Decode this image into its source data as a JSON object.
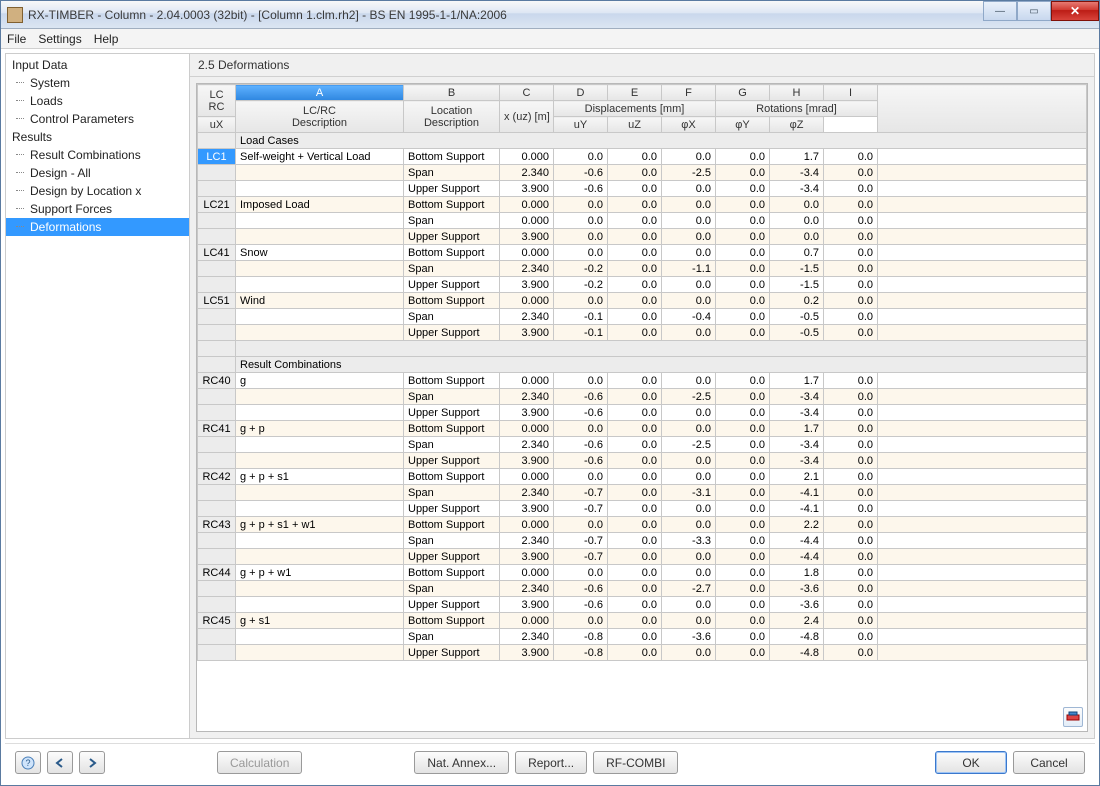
{
  "window": {
    "title": "RX-TIMBER - Column - 2.04.0003 (32bit) - [Column 1.clm.rh2] - BS EN 1995-1-1/NA:2006"
  },
  "menu": {
    "file": "File",
    "settings": "Settings",
    "help": "Help"
  },
  "tree": {
    "groups": [
      {
        "label": "Input Data",
        "items": [
          "System",
          "Loads",
          "Control Parameters"
        ]
      },
      {
        "label": "Results",
        "items": [
          "Result Combinations",
          "Design - All",
          "Design by Location x",
          "Support Forces",
          "Deformations"
        ],
        "selected": "Deformations"
      }
    ]
  },
  "panel": {
    "title": "2.5 Deformations"
  },
  "columns": {
    "letters": [
      "A",
      "B",
      "C",
      "D",
      "E",
      "F",
      "G",
      "H",
      "I"
    ],
    "lc": "LC\nRC",
    "a": "LC/RC\nDescription",
    "b": "Location\nDescription",
    "c": "x (uz) [m]",
    "disp_group": "Displacements [mm]",
    "d": "uX",
    "e": "uY",
    "f": "uZ",
    "rot_group": "Rotations [mrad]",
    "g": "φX",
    "h": "φY",
    "i": "φZ"
  },
  "sections": [
    {
      "title": "Load Cases",
      "rows": [
        {
          "lc": "LC1",
          "desc": "Self-weight + Vertical Load",
          "loc": "Bottom Support",
          "x": "0.000",
          "ux": "0.0",
          "uy": "0.0",
          "uz": "0.0",
          "px": "0.0",
          "py": "1.7",
          "pz": "0.0",
          "selected": true
        },
        {
          "lc": "",
          "desc": "",
          "loc": "Span",
          "x": "2.340",
          "ux": "-0.6",
          "uy": "0.0",
          "uz": "-2.5",
          "px": "0.0",
          "py": "-3.4",
          "pz": "0.0"
        },
        {
          "lc": "",
          "desc": "",
          "loc": "Upper Support",
          "x": "3.900",
          "ux": "-0.6",
          "uy": "0.0",
          "uz": "0.0",
          "px": "0.0",
          "py": "-3.4",
          "pz": "0.0"
        },
        {
          "lc": "LC21",
          "desc": "Imposed Load",
          "loc": "Bottom Support",
          "x": "0.000",
          "ux": "0.0",
          "uy": "0.0",
          "uz": "0.0",
          "px": "0.0",
          "py": "0.0",
          "pz": "0.0"
        },
        {
          "lc": "",
          "desc": "",
          "loc": "Span",
          "x": "0.000",
          "ux": "0.0",
          "uy": "0.0",
          "uz": "0.0",
          "px": "0.0",
          "py": "0.0",
          "pz": "0.0"
        },
        {
          "lc": "",
          "desc": "",
          "loc": "Upper Support",
          "x": "3.900",
          "ux": "0.0",
          "uy": "0.0",
          "uz": "0.0",
          "px": "0.0",
          "py": "0.0",
          "pz": "0.0"
        },
        {
          "lc": "LC41",
          "desc": "Snow",
          "loc": "Bottom Support",
          "x": "0.000",
          "ux": "0.0",
          "uy": "0.0",
          "uz": "0.0",
          "px": "0.0",
          "py": "0.7",
          "pz": "0.0"
        },
        {
          "lc": "",
          "desc": "",
          "loc": "Span",
          "x": "2.340",
          "ux": "-0.2",
          "uy": "0.0",
          "uz": "-1.1",
          "px": "0.0",
          "py": "-1.5",
          "pz": "0.0"
        },
        {
          "lc": "",
          "desc": "",
          "loc": "Upper Support",
          "x": "3.900",
          "ux": "-0.2",
          "uy": "0.0",
          "uz": "0.0",
          "px": "0.0",
          "py": "-1.5",
          "pz": "0.0"
        },
        {
          "lc": "LC51",
          "desc": "Wind",
          "loc": "Bottom Support",
          "x": "0.000",
          "ux": "0.0",
          "uy": "0.0",
          "uz": "0.0",
          "px": "0.0",
          "py": "0.2",
          "pz": "0.0"
        },
        {
          "lc": "",
          "desc": "",
          "loc": "Span",
          "x": "2.340",
          "ux": "-0.1",
          "uy": "0.0",
          "uz": "-0.4",
          "px": "0.0",
          "py": "-0.5",
          "pz": "0.0"
        },
        {
          "lc": "",
          "desc": "",
          "loc": "Upper Support",
          "x": "3.900",
          "ux": "-0.1",
          "uy": "0.0",
          "uz": "0.0",
          "px": "0.0",
          "py": "-0.5",
          "pz": "0.0"
        }
      ]
    },
    {
      "title": "Result Combinations",
      "rows": [
        {
          "lc": "RC40",
          "desc": "g",
          "loc": "Bottom Support",
          "x": "0.000",
          "ux": "0.0",
          "uy": "0.0",
          "uz": "0.0",
          "px": "0.0",
          "py": "1.7",
          "pz": "0.0"
        },
        {
          "lc": "",
          "desc": "",
          "loc": "Span",
          "x": "2.340",
          "ux": "-0.6",
          "uy": "0.0",
          "uz": "-2.5",
          "px": "0.0",
          "py": "-3.4",
          "pz": "0.0"
        },
        {
          "lc": "",
          "desc": "",
          "loc": "Upper Support",
          "x": "3.900",
          "ux": "-0.6",
          "uy": "0.0",
          "uz": "0.0",
          "px": "0.0",
          "py": "-3.4",
          "pz": "0.0"
        },
        {
          "lc": "RC41",
          "desc": "g + p",
          "loc": "Bottom Support",
          "x": "0.000",
          "ux": "0.0",
          "uy": "0.0",
          "uz": "0.0",
          "px": "0.0",
          "py": "1.7",
          "pz": "0.0"
        },
        {
          "lc": "",
          "desc": "",
          "loc": "Span",
          "x": "2.340",
          "ux": "-0.6",
          "uy": "0.0",
          "uz": "-2.5",
          "px": "0.0",
          "py": "-3.4",
          "pz": "0.0"
        },
        {
          "lc": "",
          "desc": "",
          "loc": "Upper Support",
          "x": "3.900",
          "ux": "-0.6",
          "uy": "0.0",
          "uz": "0.0",
          "px": "0.0",
          "py": "-3.4",
          "pz": "0.0"
        },
        {
          "lc": "RC42",
          "desc": "g + p + s1",
          "loc": "Bottom Support",
          "x": "0.000",
          "ux": "0.0",
          "uy": "0.0",
          "uz": "0.0",
          "px": "0.0",
          "py": "2.1",
          "pz": "0.0"
        },
        {
          "lc": "",
          "desc": "",
          "loc": "Span",
          "x": "2.340",
          "ux": "-0.7",
          "uy": "0.0",
          "uz": "-3.1",
          "px": "0.0",
          "py": "-4.1",
          "pz": "0.0"
        },
        {
          "lc": "",
          "desc": "",
          "loc": "Upper Support",
          "x": "3.900",
          "ux": "-0.7",
          "uy": "0.0",
          "uz": "0.0",
          "px": "0.0",
          "py": "-4.1",
          "pz": "0.0"
        },
        {
          "lc": "RC43",
          "desc": "g + p + s1 + w1",
          "loc": "Bottom Support",
          "x": "0.000",
          "ux": "0.0",
          "uy": "0.0",
          "uz": "0.0",
          "px": "0.0",
          "py": "2.2",
          "pz": "0.0"
        },
        {
          "lc": "",
          "desc": "",
          "loc": "Span",
          "x": "2.340",
          "ux": "-0.7",
          "uy": "0.0",
          "uz": "-3.3",
          "px": "0.0",
          "py": "-4.4",
          "pz": "0.0"
        },
        {
          "lc": "",
          "desc": "",
          "loc": "Upper Support",
          "x": "3.900",
          "ux": "-0.7",
          "uy": "0.0",
          "uz": "0.0",
          "px": "0.0",
          "py": "-4.4",
          "pz": "0.0"
        },
        {
          "lc": "RC44",
          "desc": "g + p + w1",
          "loc": "Bottom Support",
          "x": "0.000",
          "ux": "0.0",
          "uy": "0.0",
          "uz": "0.0",
          "px": "0.0",
          "py": "1.8",
          "pz": "0.0"
        },
        {
          "lc": "",
          "desc": "",
          "loc": "Span",
          "x": "2.340",
          "ux": "-0.6",
          "uy": "0.0",
          "uz": "-2.7",
          "px": "0.0",
          "py": "-3.6",
          "pz": "0.0"
        },
        {
          "lc": "",
          "desc": "",
          "loc": "Upper Support",
          "x": "3.900",
          "ux": "-0.6",
          "uy": "0.0",
          "uz": "0.0",
          "px": "0.0",
          "py": "-3.6",
          "pz": "0.0"
        },
        {
          "lc": "RC45",
          "desc": "g + s1",
          "loc": "Bottom Support",
          "x": "0.000",
          "ux": "0.0",
          "uy": "0.0",
          "uz": "0.0",
          "px": "0.0",
          "py": "2.4",
          "pz": "0.0"
        },
        {
          "lc": "",
          "desc": "",
          "loc": "Span",
          "x": "2.340",
          "ux": "-0.8",
          "uy": "0.0",
          "uz": "-3.6",
          "px": "0.0",
          "py": "-4.8",
          "pz": "0.0"
        },
        {
          "lc": "",
          "desc": "",
          "loc": "Upper Support",
          "x": "3.900",
          "ux": "-0.8",
          "uy": "0.0",
          "uz": "0.0",
          "px": "0.0",
          "py": "-4.8",
          "pz": "0.0"
        }
      ]
    }
  ],
  "buttons": {
    "calc": "Calculation",
    "annex": "Nat. Annex...",
    "report": "Report...",
    "rfcombi": "RF-COMBI",
    "ok": "OK",
    "cancel": "Cancel"
  }
}
